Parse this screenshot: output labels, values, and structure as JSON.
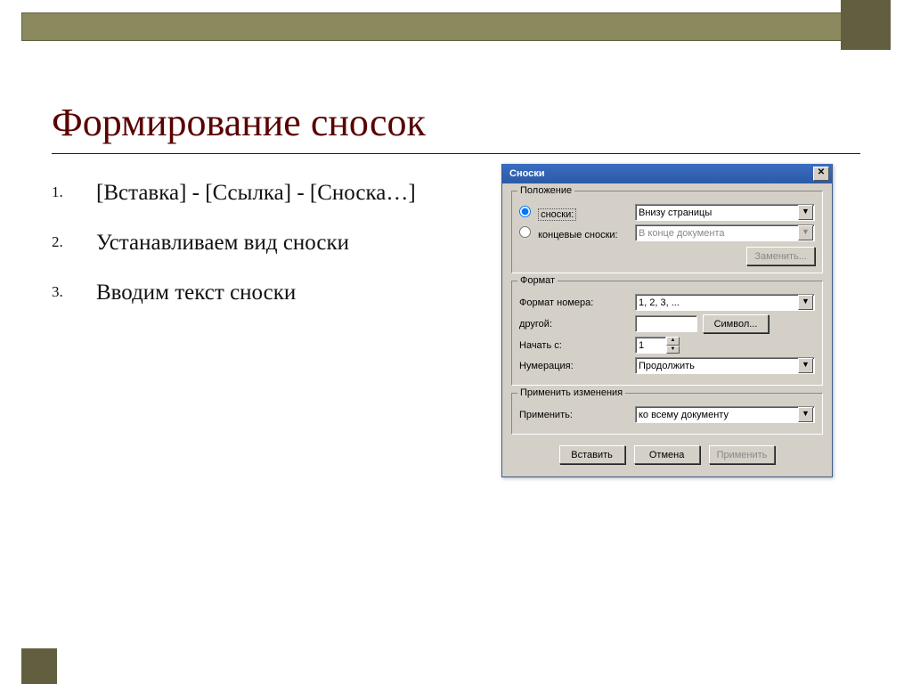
{
  "slide": {
    "title": "Формирование сносок",
    "items": [
      "[Вставка] - [Ссылка] - [Сноска…]",
      "Устанавливаем вид сноски",
      "Вводим текст сноски"
    ]
  },
  "dialog": {
    "title": "Сноски",
    "groups": {
      "position": {
        "legend": "Положение",
        "option1": "сноски:",
        "option1_value": "Внизу страницы",
        "option2": "концевые сноски:",
        "option2_value": "В конце документа",
        "swap_btn": "Заменить..."
      },
      "format": {
        "legend": "Формат",
        "number_format_label": "Формат номера:",
        "number_format_value": "1, 2, 3, ...",
        "other_label": "другой:",
        "other_value": "",
        "symbol_btn": "Символ...",
        "start_label": "Начать с:",
        "start_value": "1",
        "numbering_label": "Нумерация:",
        "numbering_value": "Продолжить"
      },
      "apply": {
        "legend": "Применить изменения",
        "apply_label": "Применить:",
        "apply_value": "ко всему документу"
      }
    },
    "buttons": {
      "insert": "Вставить",
      "cancel": "Отмена",
      "apply": "Применить"
    }
  }
}
